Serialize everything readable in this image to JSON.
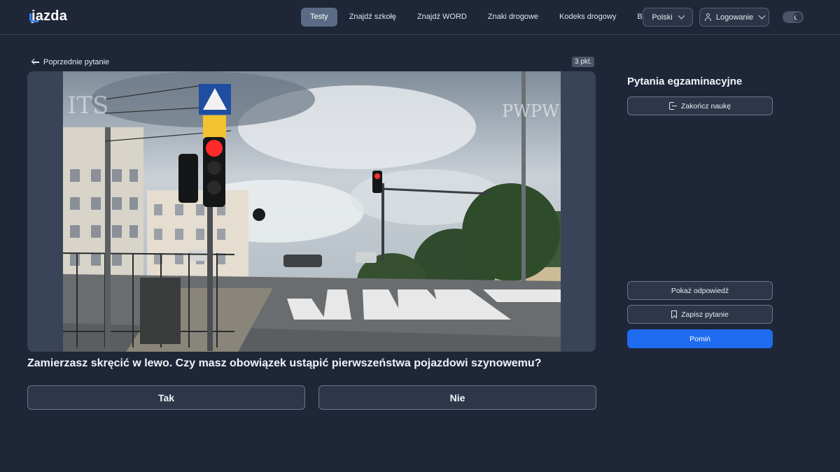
{
  "header": {
    "logo": "jazda",
    "nav": [
      {
        "label": "Testy",
        "active": true
      },
      {
        "label": "Znajdź szkołę",
        "active": false
      },
      {
        "label": "Znajdź WORD",
        "active": false
      },
      {
        "label": "Znaki drogowe",
        "active": false
      },
      {
        "label": "Kodeks drogowy",
        "active": false
      },
      {
        "label": "Blog",
        "active": false
      }
    ],
    "language": "Polski",
    "login": "Logowanie",
    "theme_toggle": "dark-mode"
  },
  "main": {
    "back_label": "Poprzednie pytanie",
    "points": "3 pkt.",
    "media": {
      "watermark_left": "ITS",
      "watermark_right": "PWPW"
    },
    "question": "Zamierzasz skręcić w lewo. Czy masz obowiązek ustąpić pierwszeństwa pojazdowi szynowemu?",
    "answers": [
      "Tak",
      "Nie"
    ]
  },
  "sidebar": {
    "title": "Pytania egzaminacyjne",
    "finish_label": "Zakończ naukę",
    "show_answer_label": "Pokaż odpowiedź",
    "save_label": "Zapisz pytanie",
    "skip_label": "Pomiń"
  },
  "colors": {
    "background": "#1e2638",
    "accent": "#1f6cf0",
    "active_nav": "#5a6b85"
  }
}
